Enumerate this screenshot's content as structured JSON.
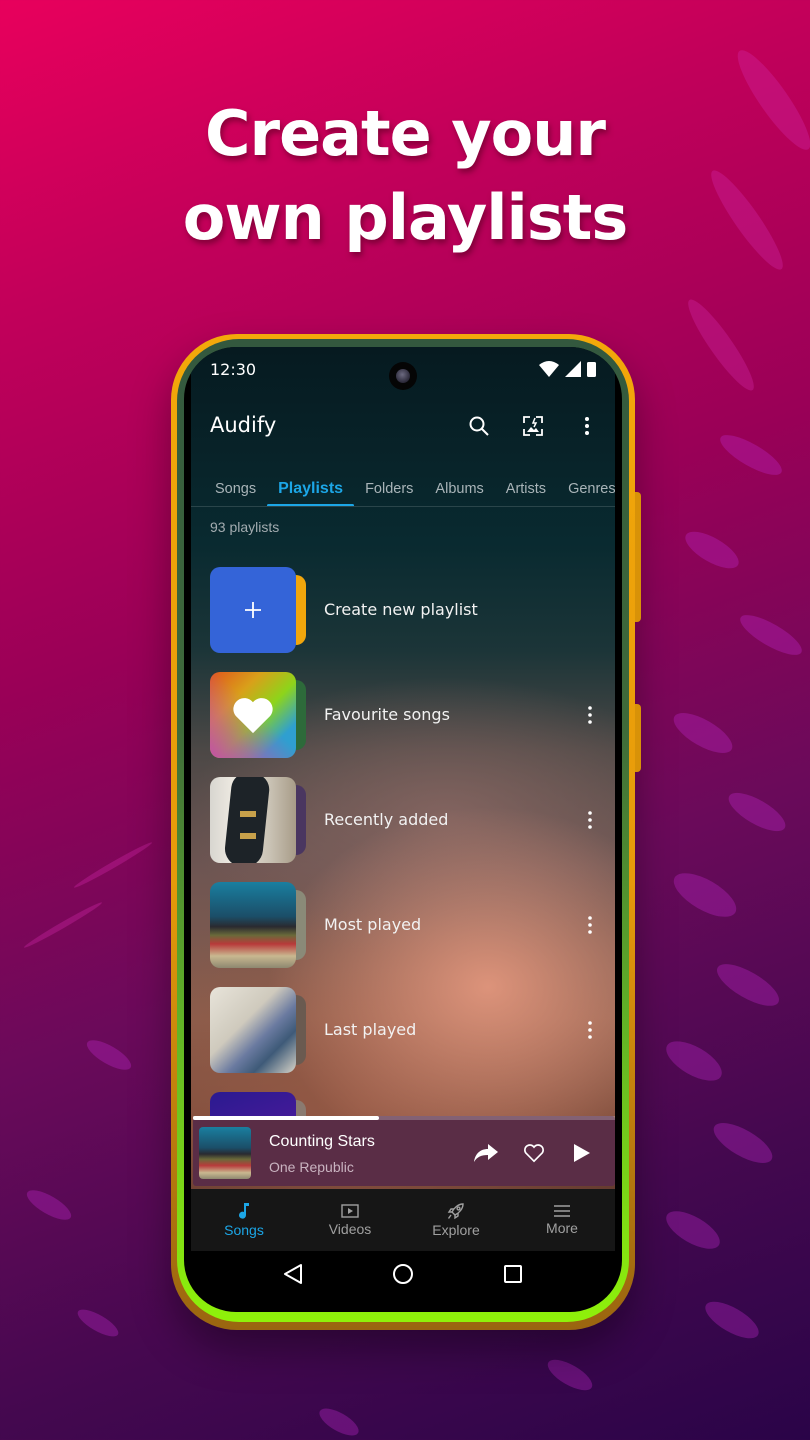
{
  "headline": {
    "line1": "Create your",
    "line2": "own playlists"
  },
  "status_bar": {
    "time": "12:30",
    "icons": [
      "wifi-icon",
      "cell-signal-icon",
      "battery-icon"
    ]
  },
  "app_bar": {
    "title": "Audify",
    "actions": [
      "search-icon",
      "theme-image-icon",
      "more-vert-icon"
    ]
  },
  "tabs": [
    {
      "label": "Songs",
      "active": false
    },
    {
      "label": "Playlists",
      "active": true
    },
    {
      "label": "Folders",
      "active": false
    },
    {
      "label": "Albums",
      "active": false
    },
    {
      "label": "Artists",
      "active": false
    },
    {
      "label": "Genres",
      "active": false
    }
  ],
  "playlist_count": "93 playlists",
  "playlists": [
    {
      "label": "Create new playlist",
      "thumb": "plus-icon",
      "has_menu": false
    },
    {
      "label": "Favourite songs",
      "thumb": "heart-icon",
      "has_menu": true
    },
    {
      "label": "Recently added",
      "thumb": "guitar-image",
      "has_menu": true
    },
    {
      "label": "Most played",
      "thumb": "mixing-console-image",
      "has_menu": true
    },
    {
      "label": "Last played",
      "thumb": "sheet-music-image",
      "has_menu": true
    }
  ],
  "mini_player": {
    "title": "Counting Stars",
    "artist": "One Republic",
    "progress": 0.44,
    "actions": [
      "share-icon",
      "heart-outline-icon",
      "play-icon"
    ]
  },
  "bottom_nav": [
    {
      "label": "Songs",
      "icon": "music-note-icon",
      "active": true
    },
    {
      "label": "Videos",
      "icon": "video-icon",
      "active": false
    },
    {
      "label": "Explore",
      "icon": "rocket-icon",
      "active": false
    },
    {
      "label": "More",
      "icon": "menu-icon",
      "active": false
    }
  ],
  "system_nav": [
    "back-icon",
    "home-icon",
    "recents-icon"
  ],
  "colors": {
    "accent": "#1ca6e6",
    "mini_player_bg": "#5a2d46",
    "create_tile": "#3464d8"
  }
}
